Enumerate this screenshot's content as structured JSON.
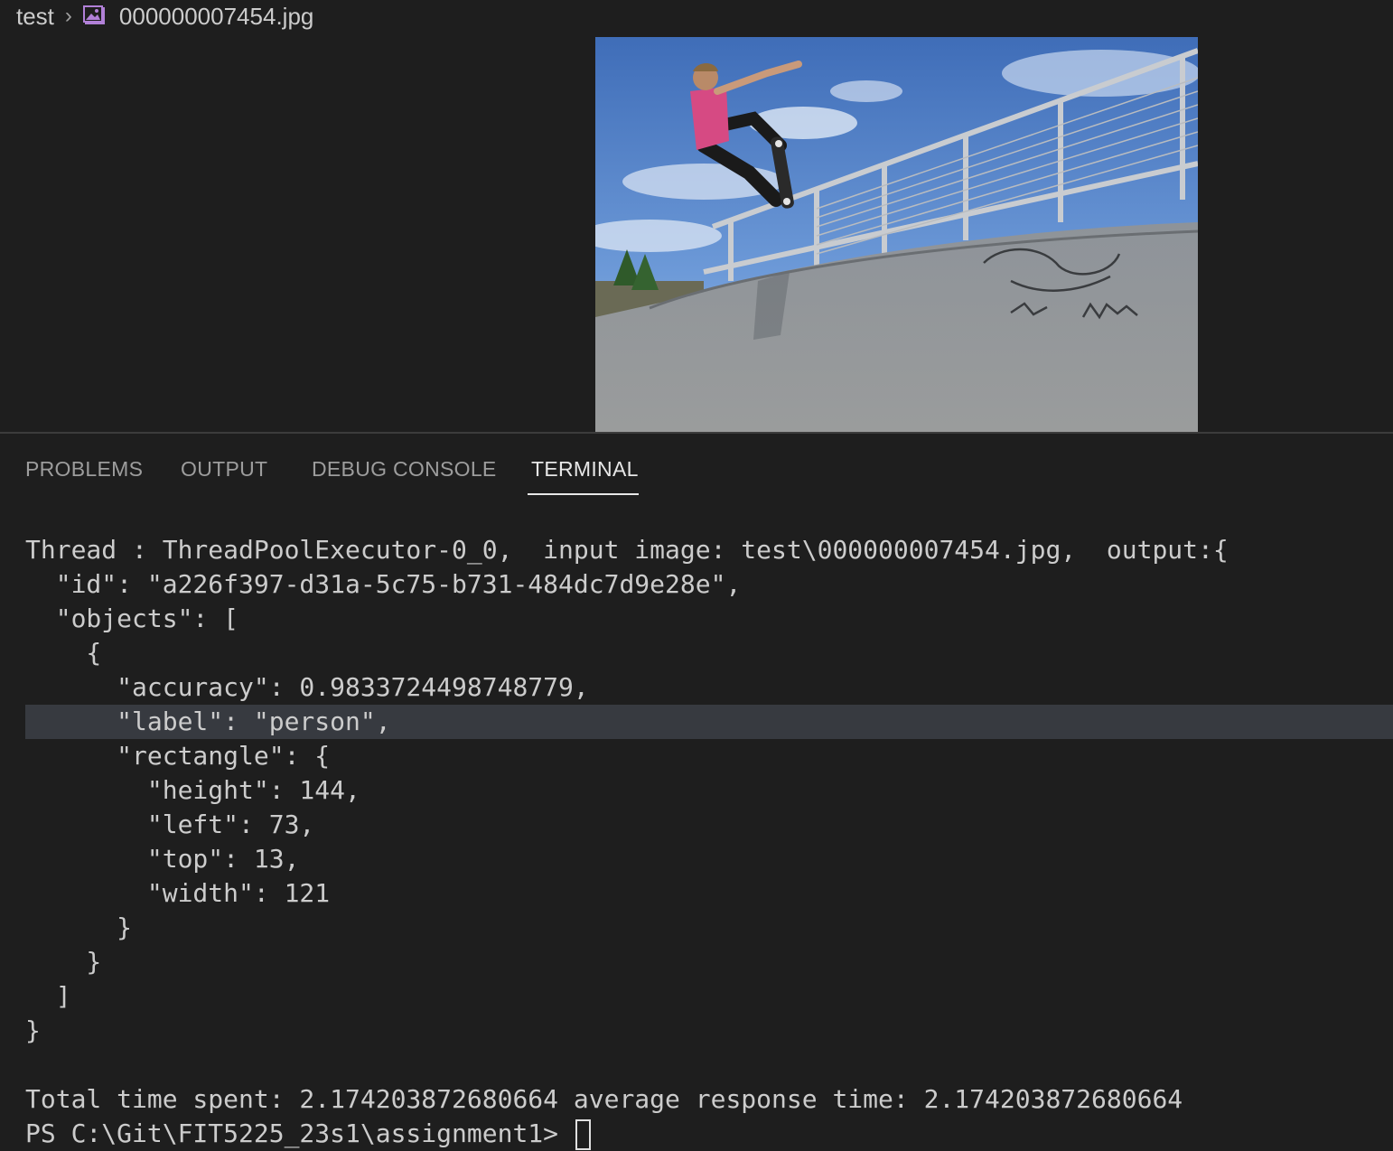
{
  "breadcrumb": {
    "folder": "test",
    "separator_icon": "chevron-right-icon",
    "file_icon": "image-file-icon",
    "file": "000000007454.jpg"
  },
  "preview": {
    "image_icon": "skateboarder-photo",
    "accent_color": "#b180d7"
  },
  "panel": {
    "tabs": [
      {
        "label": "PROBLEMS"
      },
      {
        "label": "OUTPUT"
      },
      {
        "label": "DEBUG CONSOLE"
      },
      {
        "label": "TERMINAL"
      }
    ],
    "active_tab": "TERMINAL"
  },
  "terminal": {
    "lines": [
      "Thread : ThreadPoolExecutor-0_0,  input image: test\\000000007454.jpg,  output:{",
      "  \"id\": \"a226f397-d31a-5c75-b731-484dc7d9e28e\",",
      "  \"objects\": [",
      "    {",
      "      \"accuracy\": 0.9833724498748779,",
      "      \"label\": \"person\",",
      "      \"rectangle\": {",
      "        \"height\": 144,",
      "        \"left\": 73,",
      "        \"top\": 13,",
      "        \"width\": 121",
      "      }",
      "    }",
      "  ]",
      "}",
      "",
      "Total time spent: 2.174203872680664 average response time: 2.174203872680664",
      "PS C:\\Git\\FIT5225_23s1\\assignment1> "
    ]
  }
}
